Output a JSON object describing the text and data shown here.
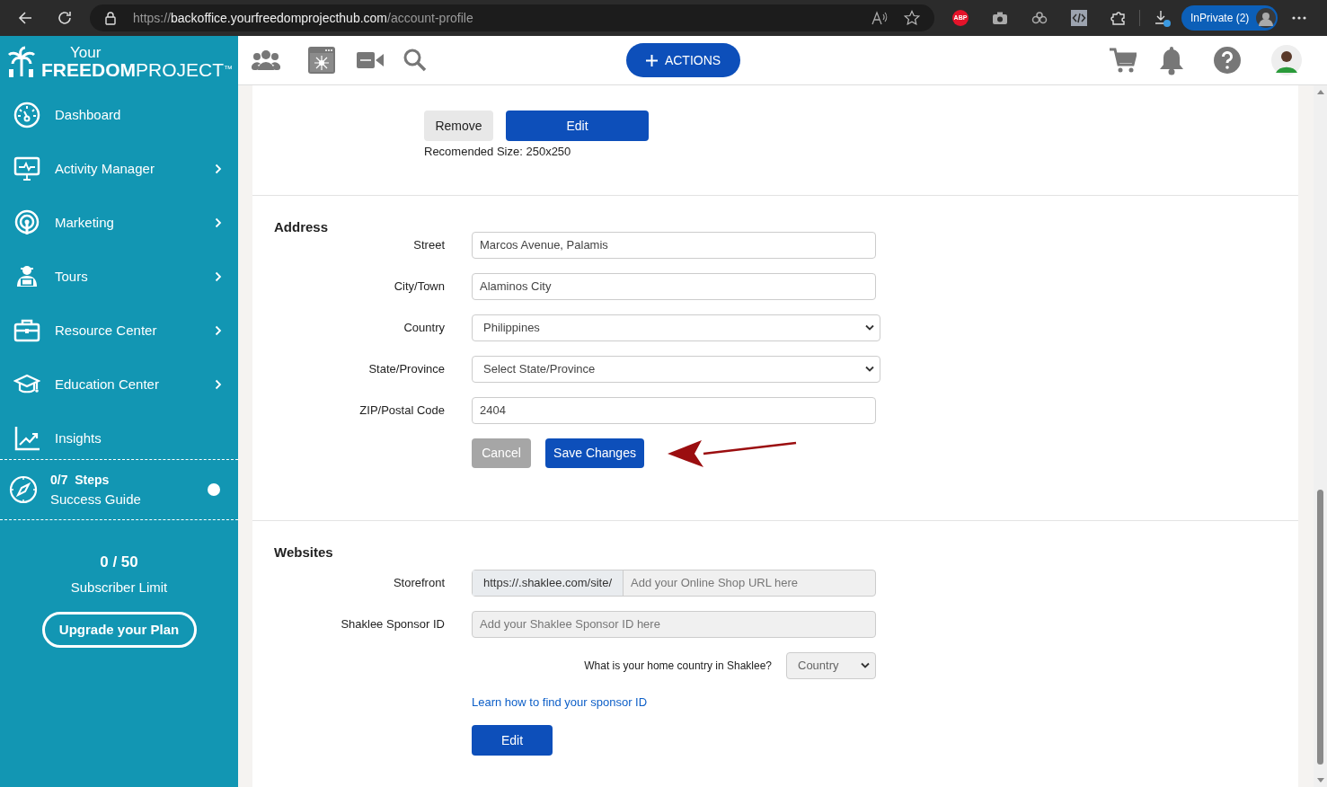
{
  "browser": {
    "url_scheme": "https://",
    "url_host": "backoffice.yourfreedomprojecthub.com",
    "url_path": "/account-profile",
    "abp_badge": "ABP",
    "profile": "InPrivate (2)"
  },
  "sidebar": {
    "logo": {
      "top": "Your",
      "main": "FREEDOM",
      "rest": "PROJECT",
      "tm": "™"
    },
    "items": [
      {
        "label": "Dashboard",
        "has_submenu": false
      },
      {
        "label": "Activity Manager",
        "has_submenu": true
      },
      {
        "label": "Marketing",
        "has_submenu": true
      },
      {
        "label": "Tours",
        "has_submenu": true
      },
      {
        "label": "Resource Center",
        "has_submenu": true
      },
      {
        "label": "Education Center",
        "has_submenu": true
      },
      {
        "label": "Insights",
        "has_submenu": false
      }
    ],
    "success_guide": {
      "steps": "0/7  Steps",
      "label": "Success Guide"
    },
    "subscriber": {
      "count": "0 / 50",
      "label": "Subscriber Limit"
    },
    "upgrade_button": "Upgrade your Plan"
  },
  "header": {
    "actions_button": "ACTIONS"
  },
  "photo": {
    "remove_button": "Remove",
    "edit_button": "Edit",
    "note": "Recomended Size: 250x250"
  },
  "address": {
    "title": "Address",
    "fields": [
      {
        "label": "Street",
        "kind": "input",
        "value": "Marcos Avenue, Palamis"
      },
      {
        "label": "City/Town",
        "kind": "input",
        "value": "Alaminos City"
      },
      {
        "label": "Country",
        "kind": "select",
        "value": "Philippines"
      },
      {
        "label": "State/Province",
        "kind": "select",
        "value": "Select State/Province"
      },
      {
        "label": "ZIP/Postal Code",
        "kind": "input",
        "value": "2404"
      }
    ],
    "cancel_button": "Cancel",
    "save_button": "Save Changes"
  },
  "websites": {
    "title": "Websites",
    "storefront_label": "Storefront",
    "storefront_prefix": "https://.shaklee.com/site/",
    "storefront_placeholder": "Add your Online Shop URL here",
    "sponsor_label": "Shaklee Sponsor ID",
    "sponsor_placeholder": "Add your Shaklee Sponsor ID here",
    "country_question": "What is your home country in Shaklee?",
    "country_select": "Country",
    "help_link": "Learn how to find your sponsor ID",
    "edit_button": "Edit"
  }
}
